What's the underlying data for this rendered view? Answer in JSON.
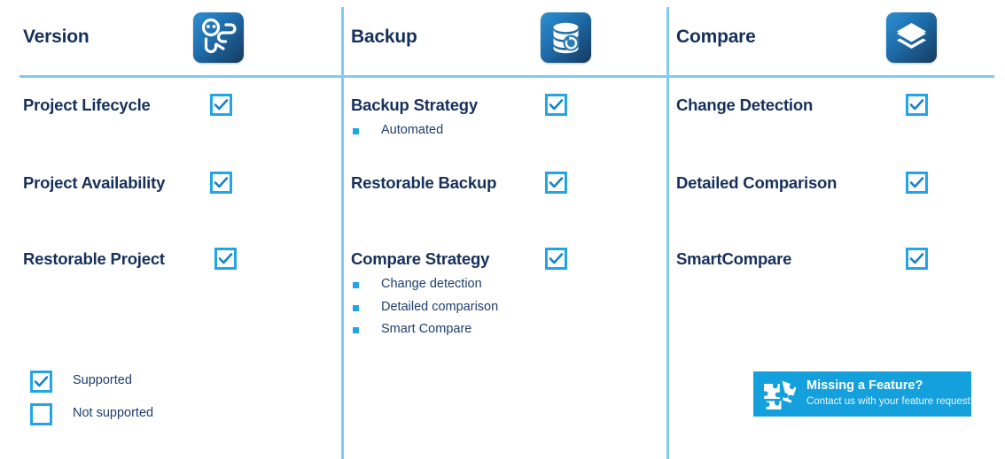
{
  "theme": {
    "navy": "#16305c",
    "accent_blue": "#22a5e8",
    "rule_blue": "#7ecbf0",
    "cta_blue": "#14a0dc",
    "tile_gradient_from": "#2d8fd0",
    "tile_gradient_to": "#16395e",
    "background": "#ffffff"
  },
  "columns": [
    {
      "title": "Version",
      "icon": "version-branch-icon",
      "features": [
        {
          "name": "Project Lifecycle",
          "supported": true,
          "sub": []
        },
        {
          "name": "Project Availability",
          "supported": true,
          "sub": []
        },
        {
          "name": "Restorable Project",
          "supported": true,
          "sub": []
        }
      ]
    },
    {
      "title": "Backup",
      "icon": "database-restore-icon",
      "features": [
        {
          "name": "Backup Strategy",
          "supported": true,
          "sub": [
            "Automated"
          ]
        },
        {
          "name": "Restorable Backup",
          "supported": true,
          "sub": []
        },
        {
          "name": "Compare Strategy",
          "supported": true,
          "sub": [
            "Change detection",
            "Detailed comparison",
            "Smart Compare"
          ]
        }
      ]
    },
    {
      "title": "Compare",
      "icon": "layers-stack-icon",
      "features": [
        {
          "name": "Change Detection",
          "supported": true,
          "sub": []
        },
        {
          "name": "Detailed Comparison",
          "supported": true,
          "sub": []
        },
        {
          "name": "SmartCompare",
          "supported": true,
          "sub": []
        }
      ]
    }
  ],
  "legend": [
    {
      "label": "Supported",
      "checked": true
    },
    {
      "label": "Not supported",
      "checked": false
    }
  ],
  "cta": {
    "icon": "puzzle-piece-icon",
    "title": "Missing a Feature?",
    "subtitle": "Contact us with your feature request!"
  }
}
